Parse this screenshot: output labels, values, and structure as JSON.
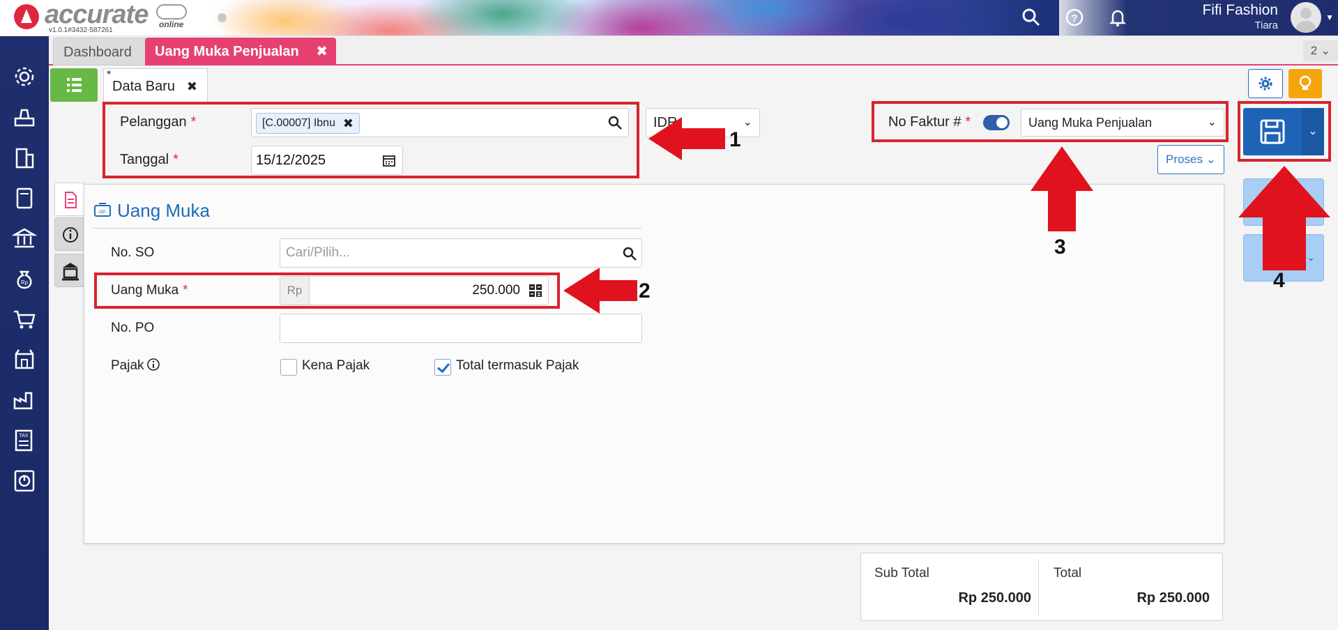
{
  "app": {
    "logo_text": "accurate",
    "logo_sub": "online",
    "version": "v1.0.1#3432-587261",
    "company": "Fifi Fashion",
    "user": "Tiara"
  },
  "tabs": {
    "dashboard": "Dashboard",
    "active": "Uang Muka Penjualan",
    "close": "✖",
    "count": "2 ⌄"
  },
  "subtab": {
    "star": "*",
    "label": "Data Baru",
    "close": "✖"
  },
  "header": {
    "customer_label": "Pelanggan",
    "required": "*",
    "customer_chip": "[C.00007] Ibnu",
    "chip_close": "✖",
    "date_label": "Tanggal",
    "date_value": "15/12/2025",
    "currency": "IDR",
    "invoice_label": "No Faktur #",
    "invoice_type": "Uang Muka Penjualan",
    "process_label": "Proses"
  },
  "section": {
    "title": "Uang Muka",
    "so_label": "No. SO",
    "so_placeholder": "Cari/Pilih...",
    "dp_label": "Uang Muka",
    "currency_prefix": "Rp",
    "dp_value": "250.000",
    "po_label": "No. PO",
    "po_value": "",
    "tax_label": "Pajak",
    "tax_option_1": "Kena Pajak",
    "tax_option_1_checked": false,
    "tax_option_2": "Total termasuk Pajak",
    "tax_option_2_checked": true
  },
  "totals": {
    "subtotal_label": "Sub Total",
    "subtotal_value": "Rp 250.000",
    "total_label": "Total",
    "total_value": "Rp 250.000"
  },
  "annotations": [
    "1",
    "2",
    "3",
    "4"
  ],
  "colors": {
    "brand_pink": "#e64071",
    "sidebar_navy": "#1f2f6e",
    "primary_blue": "#1e63b6",
    "accent_green": "#67b844",
    "accent_orange": "#f5a50b",
    "annotation_red": "#d7242f"
  },
  "icons": {
    "sidebar": [
      "gear-icon",
      "inbox-tray-icon",
      "building-icon",
      "book-icon",
      "bank-icon",
      "money-bag-icon",
      "cart-icon",
      "store-icon",
      "factory-icon",
      "tax-icon",
      "report-chart-icon"
    ]
  }
}
